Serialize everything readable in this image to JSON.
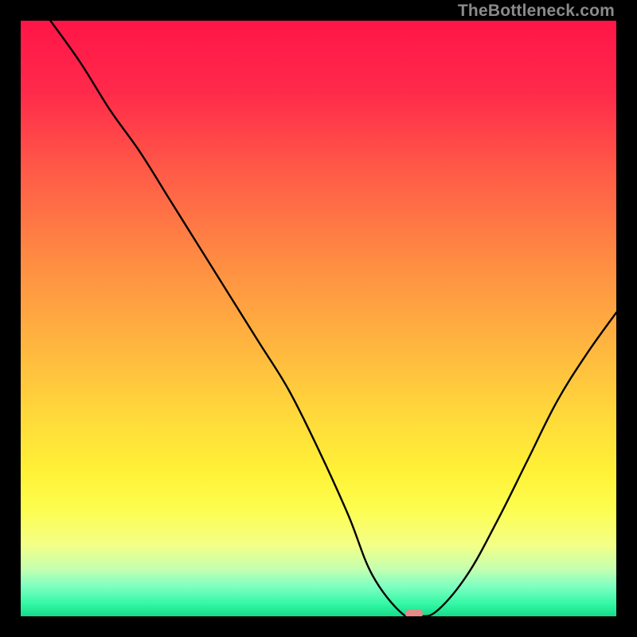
{
  "watermark": "TheBottleneck.com",
  "chart_data": {
    "type": "line",
    "title": "",
    "xlabel": "",
    "ylabel": "",
    "xlim": [
      0,
      100
    ],
    "ylim": [
      0,
      100
    ],
    "series": [
      {
        "name": "curve",
        "x": [
          5,
          10,
          15,
          20,
          25,
          30,
          35,
          40,
          45,
          50,
          55,
          59,
          64,
          67,
          70,
          75,
          80,
          85,
          90,
          95,
          100
        ],
        "y": [
          100,
          93,
          85,
          78,
          70,
          62,
          54,
          46,
          38,
          28,
          17,
          7,
          0.5,
          0,
          1,
          7,
          16,
          26,
          36,
          44,
          51
        ]
      }
    ],
    "marker": {
      "x": 66,
      "y": 0
    },
    "gradient_stops": [
      {
        "pct": 0,
        "color": "#ff1548"
      },
      {
        "pct": 12,
        "color": "#ff2a4a"
      },
      {
        "pct": 26,
        "color": "#ff5d47"
      },
      {
        "pct": 40,
        "color": "#ff8b43"
      },
      {
        "pct": 54,
        "color": "#ffb43f"
      },
      {
        "pct": 66,
        "color": "#ffd83b"
      },
      {
        "pct": 76,
        "color": "#fff237"
      },
      {
        "pct": 82,
        "color": "#fdfd4f"
      },
      {
        "pct": 88,
        "color": "#f4ff86"
      },
      {
        "pct": 92,
        "color": "#c6ffb0"
      },
      {
        "pct": 95,
        "color": "#7dffc2"
      },
      {
        "pct": 98,
        "color": "#31f7a3"
      },
      {
        "pct": 100,
        "color": "#17d98a"
      }
    ]
  }
}
